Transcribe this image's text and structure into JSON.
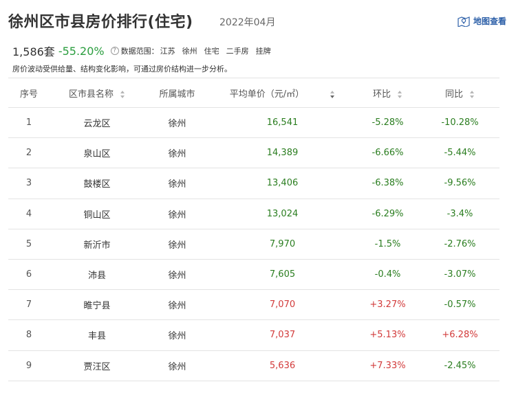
{
  "header": {
    "title": "徐州区市县房价排行(住宅)",
    "period": "2022年04月",
    "map_link": "地图查看"
  },
  "summary": {
    "count": "1,586套",
    "change": "-55.20%",
    "scope_label": "数据范围：",
    "scope": [
      "江苏",
      "徐州",
      "住宅",
      "二手房",
      "挂牌"
    ]
  },
  "note": "房价波动受供给量、结构变化影响，可通过房价结构进一步分析。",
  "table": {
    "headers": [
      "序号",
      "区市县名称",
      "所属城市",
      "平均单价（元/㎡）",
      "环比",
      "同比"
    ],
    "rows": [
      {
        "rank": "1",
        "name": "云龙区",
        "city": "徐州",
        "price": "16,541",
        "mom": "-5.28%",
        "yoy": "-10.28%"
      },
      {
        "rank": "2",
        "name": "泉山区",
        "city": "徐州",
        "price": "14,389",
        "mom": "-6.66%",
        "yoy": "-5.44%"
      },
      {
        "rank": "3",
        "name": "鼓楼区",
        "city": "徐州",
        "price": "13,406",
        "mom": "-6.38%",
        "yoy": "-9.56%"
      },
      {
        "rank": "4",
        "name": "铜山区",
        "city": "徐州",
        "price": "13,024",
        "mom": "-6.29%",
        "yoy": "-3.4%"
      },
      {
        "rank": "5",
        "name": "新沂市",
        "city": "徐州",
        "price": "7,970",
        "mom": "-1.5%",
        "yoy": "-2.76%"
      },
      {
        "rank": "6",
        "name": "沛县",
        "city": "徐州",
        "price": "7,605",
        "mom": "-0.4%",
        "yoy": "-3.07%"
      },
      {
        "rank": "7",
        "name": "睢宁县",
        "city": "徐州",
        "price": "7,070",
        "mom": "+3.27%",
        "yoy": "-0.57%"
      },
      {
        "rank": "8",
        "name": "丰县",
        "city": "徐州",
        "price": "7,037",
        "mom": "+5.13%",
        "yoy": "+6.28%"
      },
      {
        "rank": "9",
        "name": "贾汪区",
        "city": "徐州",
        "price": "5,636",
        "mom": "+7.33%",
        "yoy": "-2.45%"
      }
    ]
  },
  "colors": {
    "down": "#2a7d1f",
    "up": "#d23a3a",
    "link": "#2c5fa8"
  }
}
